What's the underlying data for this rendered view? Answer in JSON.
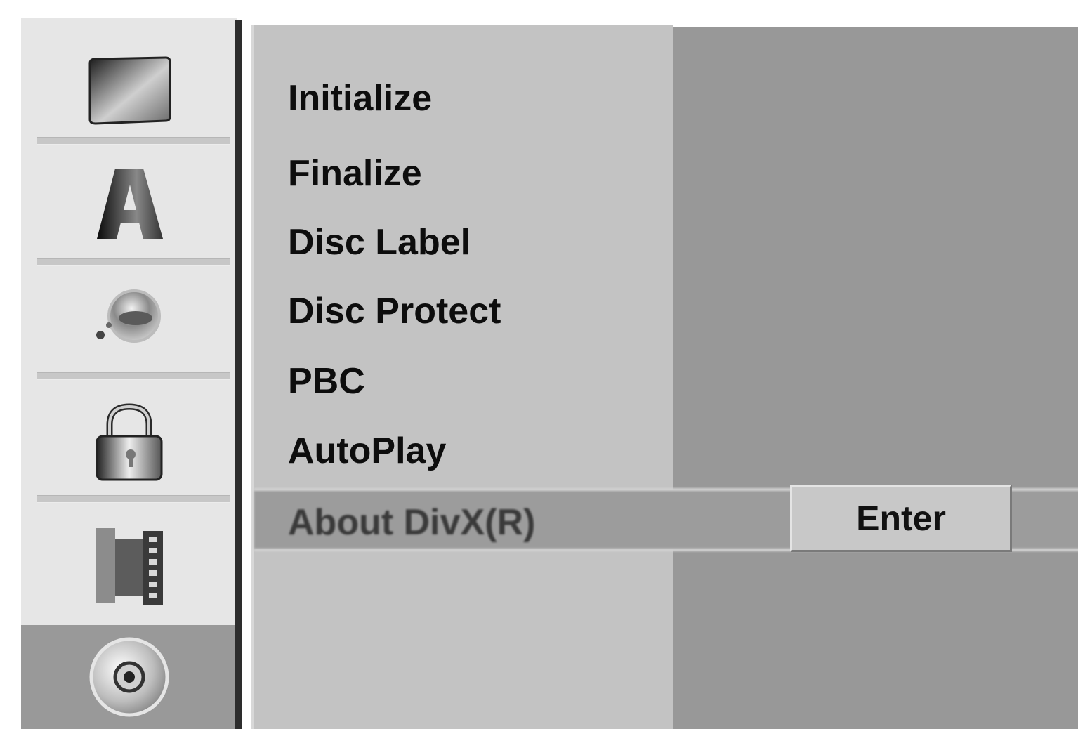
{
  "sidebar": {
    "items": [
      {
        "icon": "tv-icon"
      },
      {
        "icon": "letter-a-icon"
      },
      {
        "icon": "audio-icon"
      },
      {
        "icon": "lock-icon"
      },
      {
        "icon": "film-icon"
      },
      {
        "icon": "disc-icon",
        "active": true
      }
    ]
  },
  "menu": {
    "items": [
      {
        "label": "Initialize"
      },
      {
        "label": "Finalize"
      },
      {
        "label": "Disc Label"
      },
      {
        "label": "Disc Protect"
      },
      {
        "label": "PBC"
      },
      {
        "label": "AutoPlay"
      },
      {
        "label": "About DivX(R)",
        "selected": true
      }
    ]
  },
  "detail": {
    "enter_label": "Enter"
  },
  "colors": {
    "panel": "#c3c3c3",
    "highlight": "#9c9c9c",
    "detail_bg": "#989898",
    "sidebar_bg": "#e6e6e6",
    "sidebar_active": "#999999"
  }
}
